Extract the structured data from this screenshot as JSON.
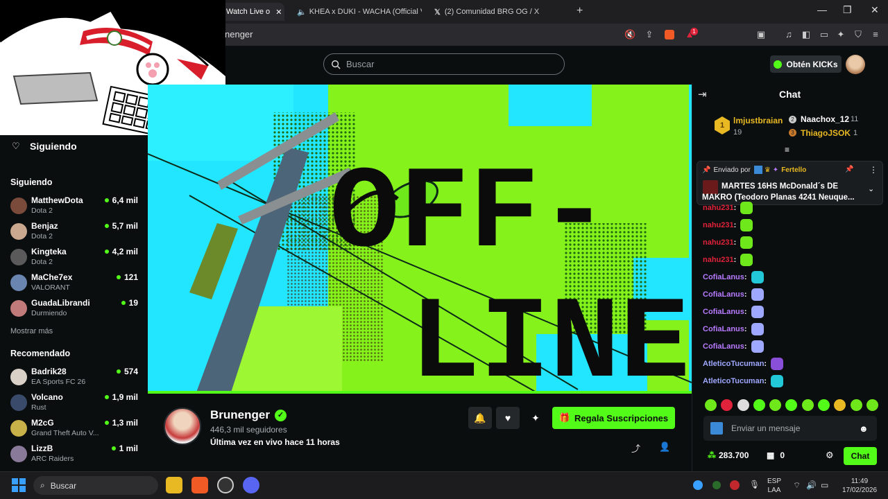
{
  "browser": {
    "tabs": [
      {
        "label": "Watch Live o",
        "active": true
      },
      {
        "label": "KHEA x DUKI - WACHA (Official V",
        "active": false
      },
      {
        "label": "(2) Comunidad BRG OG / X",
        "active": false
      }
    ],
    "url": "nenger",
    "new_tab": "+",
    "window_controls": {
      "minimize": "—",
      "maximize": "❐",
      "close": "✕"
    },
    "shield_badge": "1"
  },
  "header": {
    "search_placeholder": "Buscar",
    "kicks_button": "Obtén KICKs"
  },
  "sidebar": {
    "following_title": "Siguiendo",
    "following_section": "Siguiendo",
    "following": [
      {
        "name": "MatthewDota",
        "game": "Dota 2",
        "viewers": "6,4 mil",
        "color": "#7a4a3a"
      },
      {
        "name": "Benjaz",
        "game": "Dota 2",
        "viewers": "5,7 mil",
        "color": "#caa890"
      },
      {
        "name": "Kingteka",
        "game": "Dota 2",
        "viewers": "4,2 mil",
        "color": "#5a5a5a"
      },
      {
        "name": "MaChe7ex",
        "game": "VALORANT",
        "viewers": "121",
        "color": "#6a86b0"
      },
      {
        "name": "GuadaLibrandi",
        "game": "Durmiendo",
        "viewers": "19",
        "color": "#c07a7a"
      }
    ],
    "show_more": "Mostrar más",
    "recommended_section": "Recomendado",
    "recommended": [
      {
        "name": "Badrik28",
        "game": "EA Sports FC 26",
        "viewers": "574",
        "color": "#d9d0c8"
      },
      {
        "name": "Volcano",
        "game": "Rust",
        "viewers": "1,9 mil",
        "color": "#3a4a6a"
      },
      {
        "name": "M2cG",
        "game": "Grand Theft Auto V...",
        "viewers": "1,3 mil",
        "color": "#c9b14a"
      },
      {
        "name": "LizzB",
        "game": "ARC Raiders",
        "viewers": "1 mil",
        "color": "#8a7a9a"
      }
    ]
  },
  "channel": {
    "name": "Brunenger",
    "verified_mark": "✓",
    "followers": "446,3 mil seguidores",
    "last_live": "Última vez en vivo hace 11 horas",
    "subs_button": "Regala Suscripciones",
    "offline_line1": "OFF-",
    "offline_line2": "LINE"
  },
  "chat": {
    "title": "Chat",
    "leaderboard": [
      {
        "rank": "1",
        "name": "lmjustbraian",
        "count": "19",
        "color": "#e8b923"
      },
      {
        "rank": "2",
        "name": "Naachox_12",
        "count": "11",
        "color": "#ffffff"
      },
      {
        "rank": "3",
        "name": "ThiagoJSOK",
        "count": "1",
        "color": "#e8b923"
      }
    ],
    "pinned": {
      "sent_by": "Enviado por",
      "author": "Fertello",
      "text": "MARTES 16HS McDonald´s DE MAKRO (Teodoro Planas 4241 Neuque..."
    },
    "messages": [
      {
        "user": "nahu231",
        "color": "#e0223a"
      },
      {
        "user": "nahu231",
        "color": "#e0223a"
      },
      {
        "user": "nahu231",
        "color": "#e0223a"
      },
      {
        "user": "nahu231",
        "color": "#e0223a"
      },
      {
        "user": "CofiaLanus",
        "color": "#b77bff"
      },
      {
        "user": "CofiaLanus",
        "color": "#b77bff"
      },
      {
        "user": "CofiaLanus",
        "color": "#b77bff"
      },
      {
        "user": "CofiaLanus",
        "color": "#b77bff"
      },
      {
        "user": "CofiaLanus",
        "color": "#b77bff"
      },
      {
        "user": "AtleticoTucuman",
        "color": "#9ea8ff"
      },
      {
        "user": "AtleticoTucuman",
        "color": "#9ea8ff"
      }
    ],
    "input_placeholder": "Enviar un mensaje",
    "points": "283.700",
    "drops": "0",
    "send_button": "Chat"
  },
  "taskbar": {
    "search_placeholder": "Buscar",
    "lang": "ESP",
    "layout": "LAA",
    "time": "11:49",
    "date": "17/02/2026"
  }
}
